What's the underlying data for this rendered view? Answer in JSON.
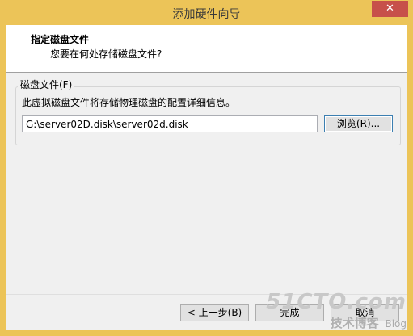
{
  "window": {
    "title": "添加硬件向导",
    "close_glyph": "✕"
  },
  "header": {
    "title": "指定磁盘文件",
    "subtitle": "您要在何处存储磁盘文件?"
  },
  "disk_file": {
    "group_label": "磁盘文件(F)",
    "description": "此虚拟磁盘文件将存储物理磁盘的配置详细信息。",
    "path_value": "G:\\server02D.disk\\server02d.disk",
    "browse_label": "浏览(R)..."
  },
  "buttons": {
    "back_label": "< 上一步(B)",
    "finish_label": "完成",
    "cancel_label": "取消"
  },
  "watermark": {
    "brand": "51CTO.com",
    "sub": "技术博客",
    "blog": "Blog"
  }
}
